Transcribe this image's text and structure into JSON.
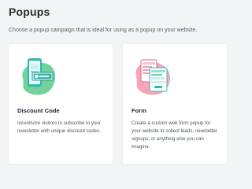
{
  "page": {
    "title": "Popups",
    "subtitle": "Choose a popup campaign that is ideal for using as a popup on your website."
  },
  "cards": [
    {
      "icon": "discount-code-illustration",
      "title": "Discount Code",
      "description": "Incentivize visitors to subscribe to your newsletter with unique discount codes."
    },
    {
      "icon": "form-illustration",
      "title": "Form",
      "description": "Create a custom web form popup for your website to collect leads, newsletter signups, or anything else you can imagine."
    }
  ],
  "colors": {
    "green": "#6fd39a",
    "teal": "#2fb8b0",
    "pink": "#f6a6b8"
  }
}
